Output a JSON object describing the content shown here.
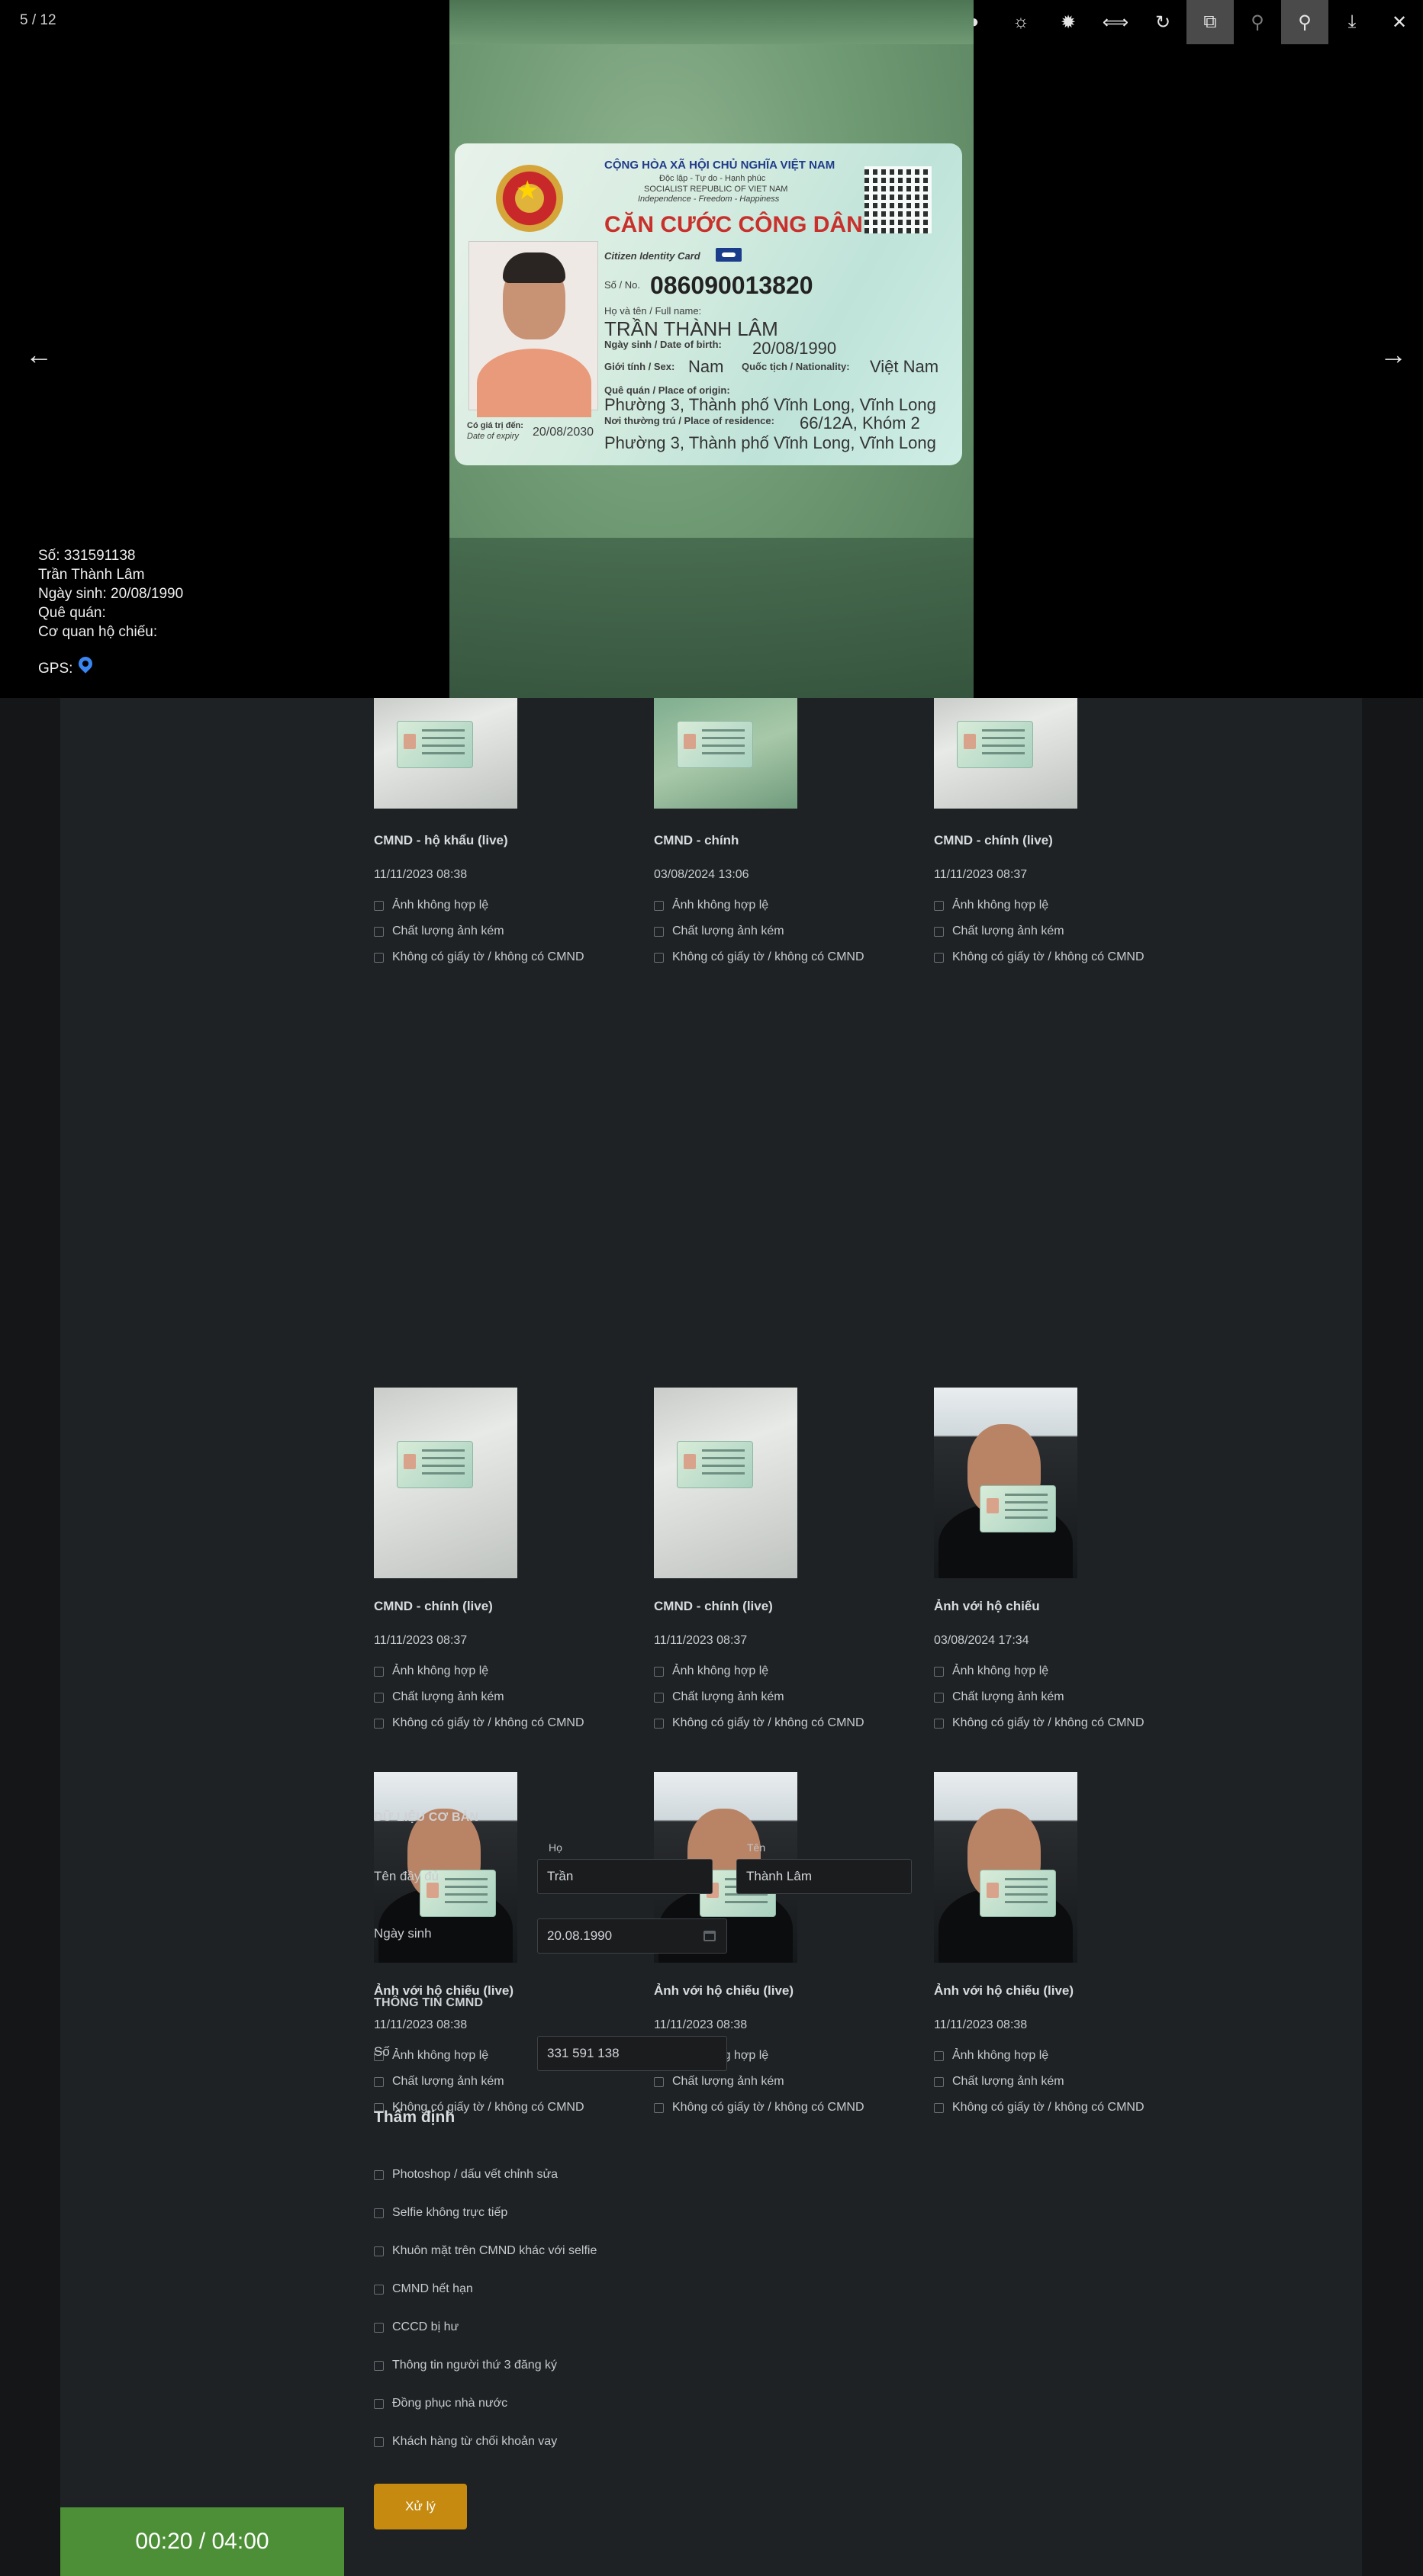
{
  "viewer": {
    "counter": "5 / 12",
    "toolbar": {
      "icons": [
        "contrast-low-icon",
        "contrast-high-icon",
        "brightness-low-icon",
        "brightness-high-icon",
        "flip-horizontal-icon",
        "rotate-icon",
        "compare-icon",
        "zoom-out-icon",
        "zoom-in-icon",
        "download-icon",
        "close-icon"
      ],
      "glyphs": [
        "◐",
        "◑",
        "☼",
        "✹",
        "⟺",
        "↻",
        "⧉",
        "⚲",
        "⚲",
        "⤓",
        "✕"
      ]
    },
    "prev_arrow": "←",
    "next_arrow": "→",
    "id_card": {
      "header_1": "CỘNG HÒA XÃ HỘI CHỦ NGHĨA VIỆT NAM",
      "header_2": "Độc lập - Tự do - Hạnh phúc",
      "header_3": "SOCIALIST REPUBLIC OF VIET NAM",
      "header_4": "Independence - Freedom - Happiness",
      "card_title": "CĂN CƯỚC CÔNG DÂN",
      "card_subtitle": "Citizen Identity Card",
      "number_label": "Số / No.",
      "number": "086090013820",
      "name_label": "Họ và tên / Full name:",
      "name": "TRẦN THÀNH LÂM",
      "dob_label": "Ngày sinh / Date of birth:",
      "dob": "20/08/1990",
      "sex_label": "Giới tính / Sex:",
      "sex": "Nam",
      "nationality_label": "Quốc tịch / Nationality:",
      "nationality": "Việt Nam",
      "origin_label": "Quê quán / Place of origin:",
      "origin": "Phường 3, Thành phố Vĩnh Long, Vĩnh Long",
      "residence_label": "Nơi thường trú / Place of residence:",
      "residence_1": "66/12A, Khóm 2",
      "residence_2": "Phường 3, Thành phố Vĩnh Long, Vĩnh Long",
      "expiry_label": "Có giá trị đến:",
      "expiry_label_en": "Date of expiry",
      "expiry": "20/08/2030"
    },
    "info": {
      "so": "Số: 331591138",
      "name": "Trần Thành Lâm",
      "dob": "Ngày sinh: 20/08/1990",
      "origin": "Quê quán:",
      "passport_office": "Cơ quan hộ chiếu:",
      "gps_label": "GPS:"
    }
  },
  "checklist_labels": [
    "Ảnh không hợp lệ",
    "Chất lượng ảnh kém",
    "Không có giấy tờ / không có CMND"
  ],
  "photos": [
    {
      "title": "CMND - hộ khẩu (live)",
      "date": "11/11/2023 08:38",
      "thumb": "wall"
    },
    {
      "title": "CMND - chính",
      "date": "03/08/2024 13:06",
      "thumb": "green"
    },
    {
      "title": "CMND - chính (live)",
      "date": "11/11/2023 08:37",
      "thumb": "wall"
    },
    {
      "title": "CMND - chính (live)",
      "date": "11/11/2023 08:37",
      "thumb": "wall"
    },
    {
      "title": "CMND - chính (live)",
      "date": "11/11/2023 08:37",
      "thumb": "wall"
    },
    {
      "title": "Ảnh với hộ chiếu",
      "date": "03/08/2024 17:34",
      "thumb": "face"
    },
    {
      "title": "Ảnh với hộ chiếu (live)",
      "date": "11/11/2023 08:38",
      "thumb": "face"
    },
    {
      "title": "Ảnh với hộ chiếu (live)",
      "date": "11/11/2023 08:38",
      "thumb": "face"
    },
    {
      "title": "Ảnh với hộ chiếu (live)",
      "date": "11/11/2023 08:38",
      "thumb": "face"
    }
  ],
  "basic_data": {
    "section_title": "DỮ LIỆU CƠ BẢN",
    "full_name_label": "Tên đầy đủ",
    "last_name_label": "Họ",
    "first_name_label": "Tên",
    "last_name_value": "Trần",
    "first_name_value": "Thành Lâm",
    "dob_label": "Ngày sinh",
    "dob_value": "20.08.1990"
  },
  "id_info": {
    "section_title": "THÔNG TIN CMND",
    "number_label": "Số",
    "number_value": "331 591 138"
  },
  "verification": {
    "title": "Thẩm định",
    "items": [
      "Photoshop / dấu vết chỉnh sửa",
      "Selfie không trực tiếp",
      "Khuôn mặt trên CMND khác với selfie",
      "CMND hết hạn",
      "CCCD bị hư",
      "Thông tin người thứ 3 đăng ký",
      "Đồng phục nhà nước",
      "Khách hàng từ chối khoản vay"
    ],
    "process_button": "Xử lý"
  },
  "timer": "00:20 / 04:00"
}
